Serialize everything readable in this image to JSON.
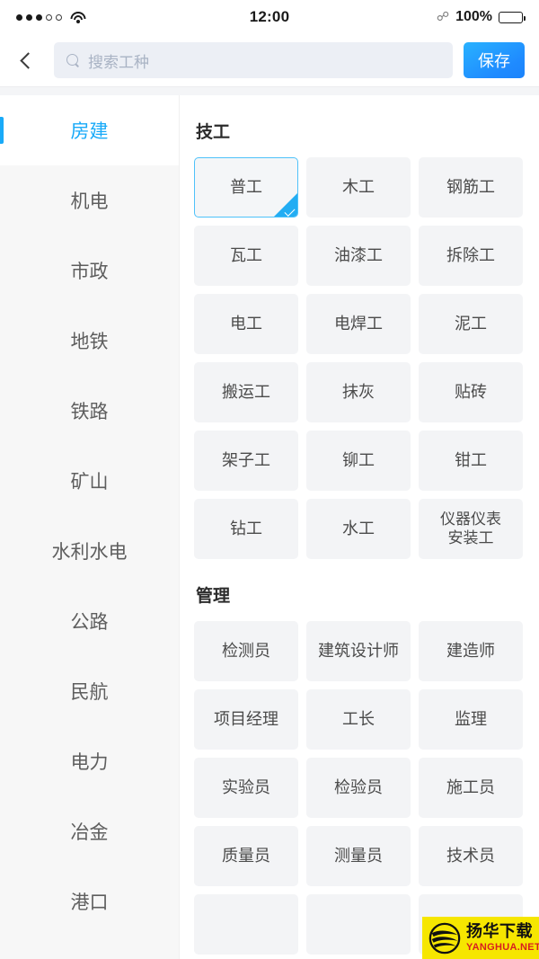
{
  "status_bar": {
    "signal_dots_filled": 3,
    "signal_dots_total": 5,
    "wifi_icon": "wifi-icon",
    "time": "12:00",
    "bluetooth_icon": "bluetooth-icon",
    "battery_percent": "100%",
    "battery_icon": "battery-full-icon"
  },
  "header": {
    "back_icon": "chevron-left-icon",
    "search": {
      "icon": "search-icon",
      "placeholder": "搜索工种",
      "value": ""
    },
    "save_label": "保存"
  },
  "sidebar": {
    "active_index": 0,
    "items": [
      {
        "label": "房建"
      },
      {
        "label": "机电"
      },
      {
        "label": "市政"
      },
      {
        "label": "地铁"
      },
      {
        "label": "铁路"
      },
      {
        "label": "矿山"
      },
      {
        "label": "水利水电"
      },
      {
        "label": "公路"
      },
      {
        "label": "民航"
      },
      {
        "label": "电力"
      },
      {
        "label": "冶金"
      },
      {
        "label": "港口"
      }
    ]
  },
  "content": {
    "sections": [
      {
        "title": "技工",
        "tiles": [
          {
            "label": "普工",
            "selected": true
          },
          {
            "label": "木工",
            "selected": false
          },
          {
            "label": "钢筋工",
            "selected": false
          },
          {
            "label": "瓦工",
            "selected": false
          },
          {
            "label": "油漆工",
            "selected": false
          },
          {
            "label": "拆除工",
            "selected": false
          },
          {
            "label": "电工",
            "selected": false
          },
          {
            "label": "电焊工",
            "selected": false
          },
          {
            "label": "泥工",
            "selected": false
          },
          {
            "label": "搬运工",
            "selected": false
          },
          {
            "label": "抹灰",
            "selected": false
          },
          {
            "label": "贴砖",
            "selected": false
          },
          {
            "label": "架子工",
            "selected": false
          },
          {
            "label": "铆工",
            "selected": false
          },
          {
            "label": "钳工",
            "selected": false
          },
          {
            "label": "钻工",
            "selected": false
          },
          {
            "label": "水工",
            "selected": false
          },
          {
            "label": "仪器仪表\n安装工",
            "selected": false,
            "two_line": true
          }
        ]
      },
      {
        "title": "管理",
        "tiles": [
          {
            "label": "检测员",
            "selected": false
          },
          {
            "label": "建筑设计师",
            "selected": false
          },
          {
            "label": "建造师",
            "selected": false
          },
          {
            "label": "项目经理",
            "selected": false
          },
          {
            "label": "工长",
            "selected": false
          },
          {
            "label": "监理",
            "selected": false
          },
          {
            "label": "实验员",
            "selected": false
          },
          {
            "label": "检验员",
            "selected": false
          },
          {
            "label": "施工员",
            "selected": false
          },
          {
            "label": "质量员",
            "selected": false
          },
          {
            "label": "测量员",
            "selected": false
          },
          {
            "label": "技术员",
            "selected": false
          },
          {
            "label": "",
            "selected": false,
            "partial": true
          },
          {
            "label": "",
            "selected": false,
            "partial": true
          },
          {
            "label": "",
            "selected": false,
            "partial": true
          }
        ]
      }
    ]
  },
  "watermark": {
    "cn": "扬华下载",
    "en": "YANGHUA.NET",
    "bg": "#f6e600",
    "en_color": "#d81f1f"
  },
  "colors": {
    "accent": "#19aaf8",
    "save_button": "#1f8bff",
    "tile_bg": "#f3f4f6",
    "sidebar_bg": "#f7f7f7",
    "selected_border": "#4ec2fa"
  }
}
